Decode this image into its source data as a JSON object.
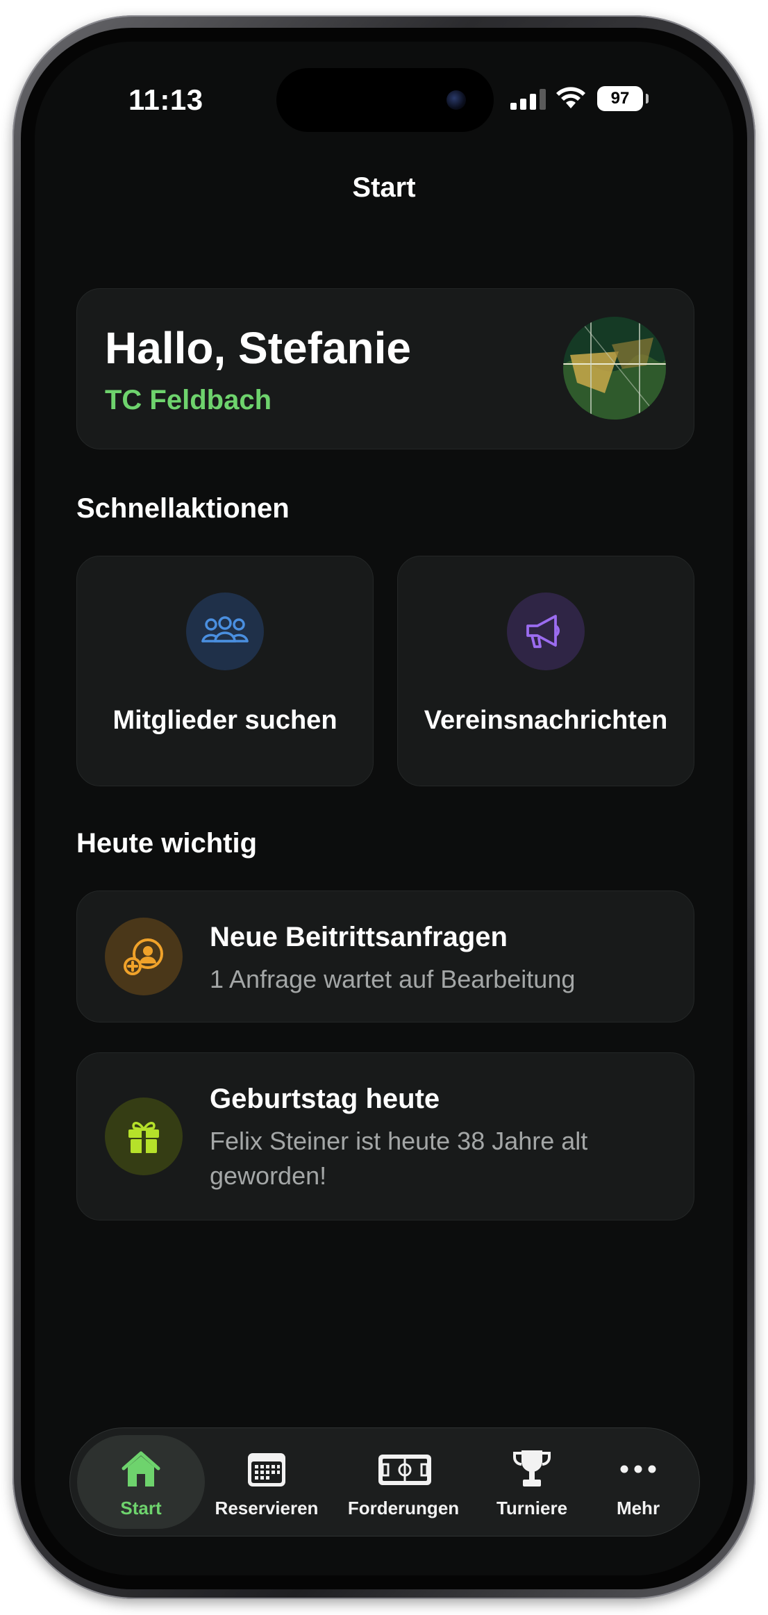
{
  "status_bar": {
    "time": "11:13",
    "battery": "97"
  },
  "nav": {
    "title": "Start"
  },
  "greeting": {
    "hello": "Hallo, Stefanie",
    "club": "TC Feldbach"
  },
  "quick_actions": {
    "heading": "Schnellaktionen",
    "items": [
      {
        "label": "Mitglieder suchen",
        "icon": "members-icon",
        "color": "#4a8fe0"
      },
      {
        "label": "Vereinsnachrichten",
        "icon": "megaphone-icon",
        "color": "#9b6cf0"
      }
    ]
  },
  "today": {
    "heading": "Heute wichtig",
    "items": [
      {
        "title": "Neue Beitrittsanfragen",
        "subtitle": "1 Anfrage wartet auf Bearbeitung",
        "icon": "user-add-icon",
        "color": "#f0a22a"
      },
      {
        "title": "Geburtstag heute",
        "subtitle": "Felix Steiner ist heute 38 Jahre alt geworden!",
        "icon": "gift-icon",
        "color": "#b6e12a"
      }
    ]
  },
  "tabbar": {
    "items": [
      {
        "label": "Start",
        "icon": "home-icon",
        "active": true
      },
      {
        "label": "Reservieren",
        "icon": "calendar-icon",
        "active": false
      },
      {
        "label": "Forderungen",
        "icon": "court-icon",
        "active": false
      },
      {
        "label": "Turniere",
        "icon": "trophy-icon",
        "active": false
      },
      {
        "label": "Mehr",
        "icon": "more-icon",
        "active": false
      }
    ]
  },
  "colors": {
    "accent": "#6ed36d",
    "background": "#0c0d0d",
    "card": "#181a1a"
  }
}
